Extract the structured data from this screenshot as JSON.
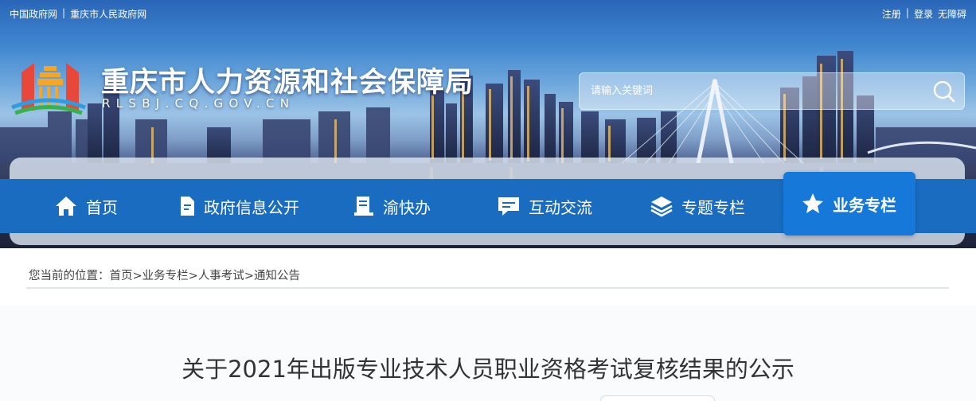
{
  "topbar": {
    "left_links": [
      "中国政府网",
      "重庆市人民政府网"
    ],
    "right_links": [
      "注册",
      "登录",
      "无障碍"
    ]
  },
  "header": {
    "title": "重庆市人力资源和社会保障局",
    "domain": "RLSBJ.CQ.GOV.CN"
  },
  "search": {
    "placeholder": "请输入关键词"
  },
  "nav": {
    "items": [
      {
        "label": "首页",
        "icon": "home-icon"
      },
      {
        "label": "政府信息公开",
        "icon": "document-icon"
      },
      {
        "label": "渝快办",
        "icon": "service-icon"
      },
      {
        "label": "互动交流",
        "icon": "chat-icon"
      },
      {
        "label": "专题专栏",
        "icon": "layers-icon"
      },
      {
        "label": "业务专栏",
        "icon": "star-icon",
        "active": true
      }
    ]
  },
  "breadcrumb": {
    "prefix": "您当前的位置：",
    "items": [
      "首页",
      "业务专栏",
      "人事考试",
      "通知公告"
    ],
    "separator": ">"
  },
  "article": {
    "title": "关于2021年出版专业技术人员职业资格考试复核结果的公示"
  },
  "colors": {
    "nav_blue": "#1a6cc1",
    "nav_active": "#1678d8",
    "title_text": "#333333"
  }
}
